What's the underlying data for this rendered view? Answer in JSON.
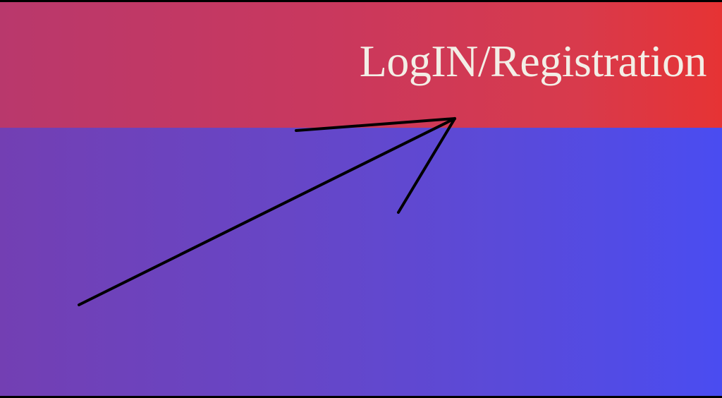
{
  "header": {
    "login_label": "LogIN/Registration"
  },
  "annotation": {
    "icon": "arrow-icon",
    "color": "#000000"
  },
  "colors": {
    "header_start": "#b9386c",
    "header_end": "#e63334",
    "body_start": "#733fb3",
    "body_end": "#4a4cf1",
    "text": "#f3eee6"
  }
}
